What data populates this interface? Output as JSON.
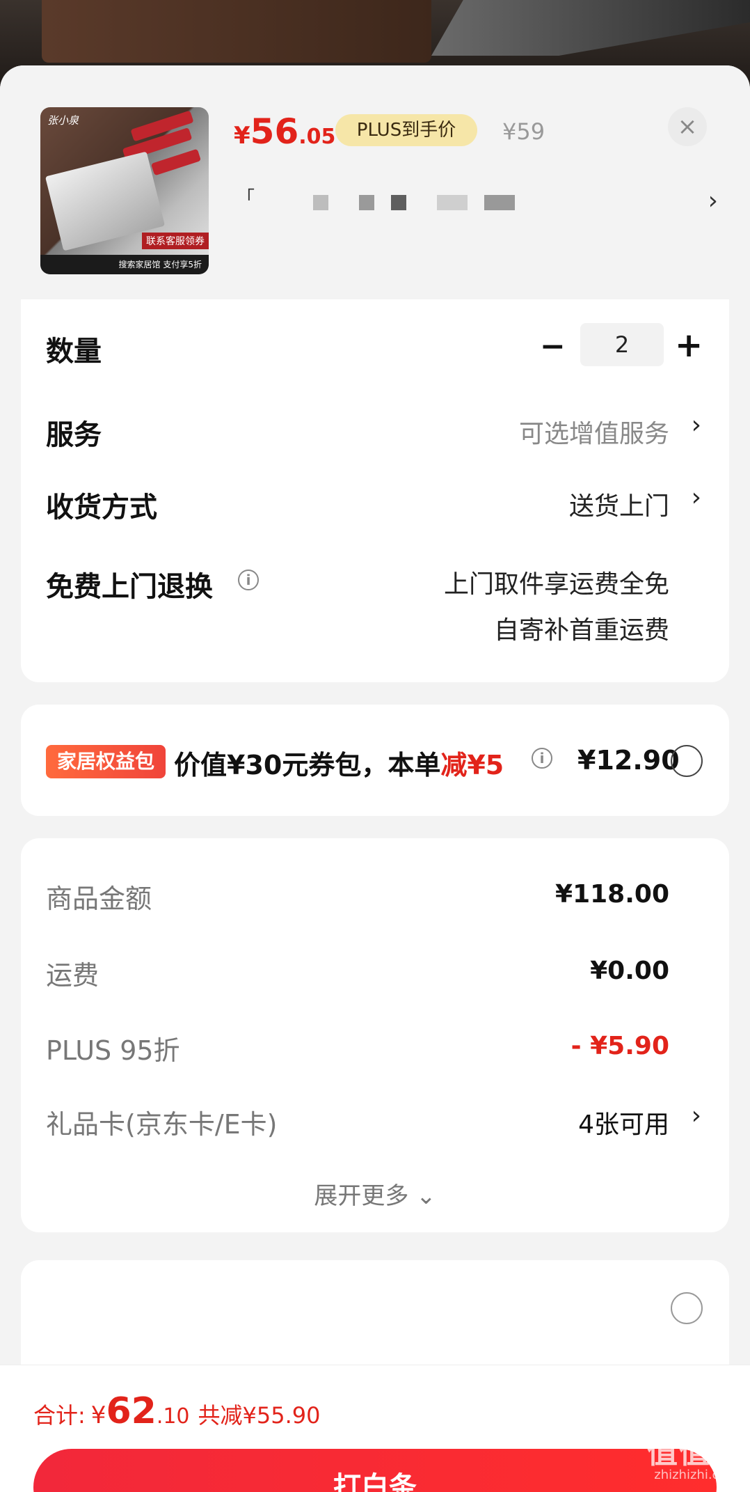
{
  "product": {
    "thumb_brand": "张小泉",
    "thumb_promo": "联系客服领券",
    "thumb_footer": "搜索家居馆 支付享5折",
    "price_currency": "¥",
    "price_integer": "56",
    "price_decimal": ".05",
    "plus_tag": "PLUS到手价",
    "original_price": "¥59",
    "close_icon": "×",
    "spec_mark": "「",
    "spec_chevron": "›"
  },
  "options": {
    "quantity_label": "数量",
    "quantity_minus": "−",
    "quantity_value": "2",
    "quantity_plus": "+",
    "service_label": "服务",
    "service_value": "可选增值服务",
    "delivery_label": "收货方式",
    "delivery_value": "送货上门",
    "return_label": "免费上门退换",
    "return_value_1": "上门取件享运费全免",
    "return_value_2": "自寄补首重运费",
    "chevron": "›",
    "info": "i"
  },
  "benefit": {
    "tag": "家居权益包",
    "text_prefix": "价值¥30元券包，本单",
    "text_highlight": "减¥5",
    "price": "¥12.90"
  },
  "summary": {
    "goods_label": "商品金额",
    "goods_value": "¥118.00",
    "shipping_label": "运费",
    "shipping_value": "¥0.00",
    "plus_label": "PLUS 95折",
    "plus_value": "- ¥5.90",
    "giftcard_label": "礼品卡(京东卡/E卡)",
    "giftcard_value": "4张可用",
    "expand": "展开更多 ⌄"
  },
  "footer": {
    "total_label": "合计:",
    "total_currency": "¥",
    "total_integer": "62",
    "total_decimal": ".10",
    "total_save": "共减¥55.90",
    "pay_button": "打白条"
  },
  "watermark": {
    "text": "值值值",
    "sub": "zhizhizhi.com"
  },
  "colors": {
    "accent": "#e2231a",
    "plus_tag_bg": "#f6e6a8",
    "pay_button": "#f2283a"
  }
}
